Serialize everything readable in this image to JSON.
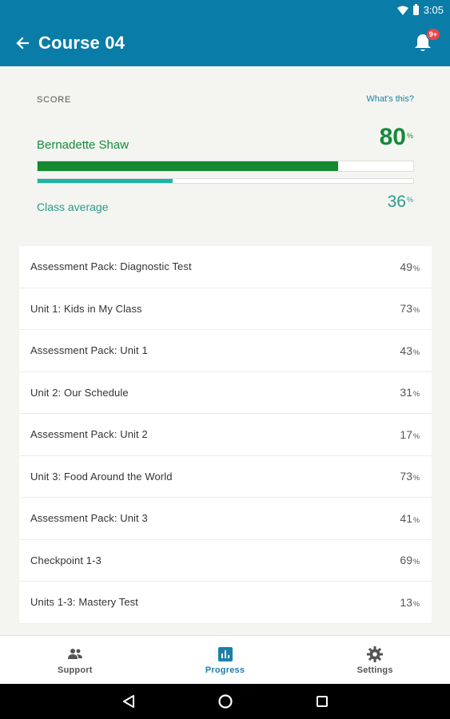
{
  "status_bar": {
    "time": "3:05"
  },
  "app_bar": {
    "title": "Course 04",
    "notification_badge": "9+"
  },
  "score": {
    "section_label": "SCORE",
    "whats_this": "What's this?",
    "student_name": "Bernadette Shaw",
    "student_score": "80",
    "student_progress_fraction": 0.8,
    "class_label": "Class average",
    "class_score": "36",
    "class_progress_fraction": 0.36,
    "pct": "%"
  },
  "items": [
    {
      "name": "Assessment Pack: Diagnostic Test",
      "score": "49"
    },
    {
      "name": "Unit 1: Kids in My Class",
      "score": "73"
    },
    {
      "name": "Assessment Pack: Unit 1",
      "score": "43"
    },
    {
      "name": "Unit 2: Our Schedule",
      "score": "31"
    },
    {
      "name": "Assessment Pack: Unit 2",
      "score": "17"
    },
    {
      "name": "Unit 3: Food Around the World",
      "score": "73"
    },
    {
      "name": "Assessment Pack: Unit 3",
      "score": "41"
    },
    {
      "name": "Checkpoint 1-3",
      "score": "69"
    },
    {
      "name": "Units 1-3: Mastery Test",
      "score": "13"
    }
  ],
  "bottom_nav": {
    "support": "Support",
    "progress": "Progress",
    "settings": "Settings"
  },
  "colors": {
    "app_bar": "#0a7ca8",
    "student": "#138a3a",
    "class_avg": "#1cb4a4",
    "active_nav": "#1e7fa6",
    "badge": "#e84545"
  }
}
